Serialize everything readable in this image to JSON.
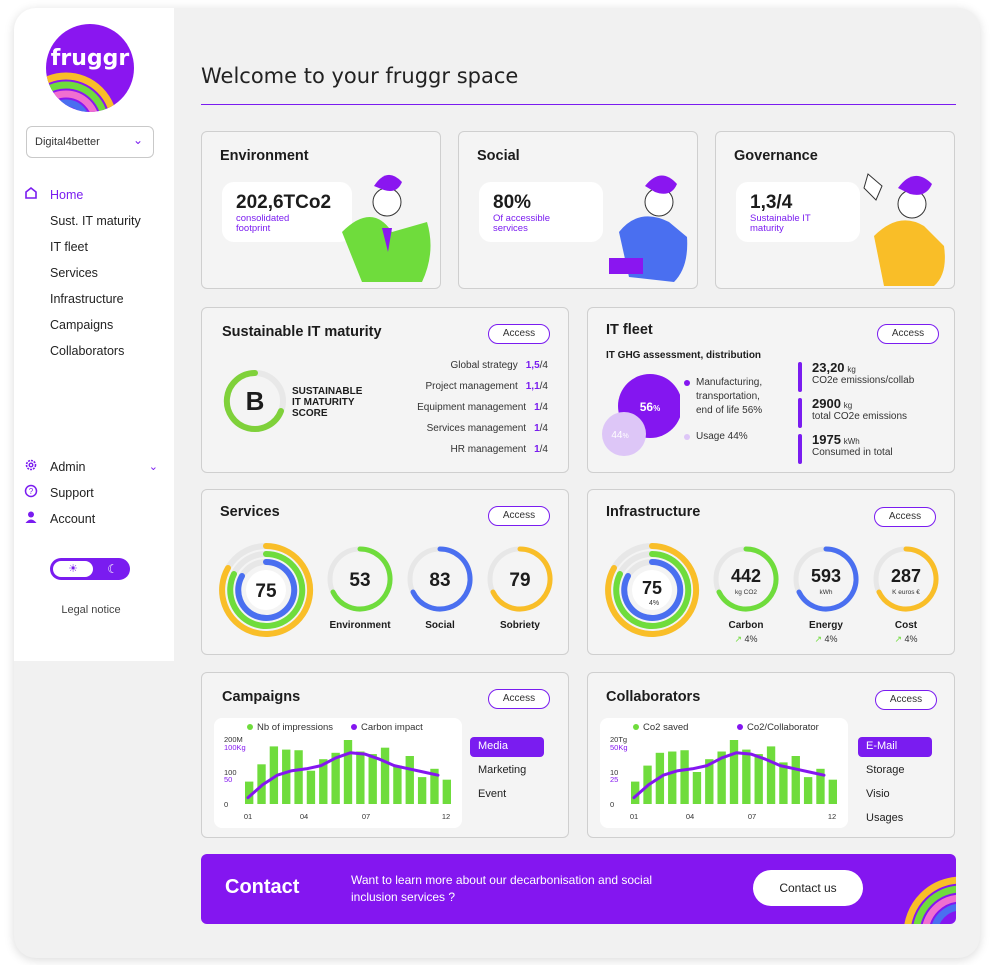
{
  "brand": {
    "name": "fruggr",
    "accent": "#7a1cf0"
  },
  "sidebar": {
    "org_select": "Digital4better",
    "items": [
      {
        "label": "Home",
        "icon": "home-icon"
      },
      {
        "label": "Sust. IT maturity"
      },
      {
        "label": "IT fleet"
      },
      {
        "label": "Services"
      },
      {
        "label": "Infrastructure"
      },
      {
        "label": "Campaigns"
      },
      {
        "label": "Collaborators"
      }
    ],
    "bottom": [
      {
        "label": "Admin",
        "icon": "gear-icon"
      },
      {
        "label": "Support",
        "icon": "help-icon"
      },
      {
        "label": "Account",
        "icon": "user-icon"
      }
    ],
    "legal": "Legal notice"
  },
  "main": {
    "title": "Welcome to your fruggr space"
  },
  "cards": {
    "environment": {
      "title": "Environment",
      "value": "202,6TCo2",
      "sub1": "consolidated",
      "sub2": "footprint"
    },
    "social": {
      "title": "Social",
      "value": "80%",
      "sub1": "Of accessible",
      "sub2": "services"
    },
    "governance": {
      "title": "Governance",
      "value": "1,3/4",
      "sub1": "Sustainable IT",
      "sub2": "maturity"
    }
  },
  "maturity": {
    "title": "Sustainable IT maturity",
    "access": "Access",
    "grade": "B",
    "score_l1": "SUSTAINABLE",
    "score_l2": "IT MATURITY",
    "score_l3": "SCORE",
    "rows": [
      {
        "label": "Global strategy",
        "value": "1,5",
        "max": "/4"
      },
      {
        "label": "Project management",
        "value": "1,1",
        "max": "/4"
      },
      {
        "label": "Equipment management",
        "value": "1",
        "max": "/4"
      },
      {
        "label": "Services management",
        "value": "1",
        "max": "/4"
      },
      {
        "label": "HR management",
        "value": "1",
        "max": "/4"
      }
    ]
  },
  "fleet": {
    "title": "IT fleet",
    "access": "Access",
    "subtitle": "IT GHG assessment, distribution",
    "big_pct": "56",
    "big_unit": "%",
    "small_pct": "44",
    "small_unit": "%",
    "legend1_a": "Manufacturing,",
    "legend1_b": "transportation,",
    "legend1_c": "end of life 56%",
    "legend2": "Usage 44%",
    "metrics": [
      {
        "value": "23,20",
        "unit": "kg",
        "label": "CO2e emissions/collab"
      },
      {
        "value": "2900",
        "unit": "kg",
        "label": "total CO2e emissions"
      },
      {
        "value": "1975",
        "unit": "kWh",
        "label": "Consumed in total"
      }
    ]
  },
  "services": {
    "title": "Services",
    "access": "Access",
    "main": "75",
    "gauges": [
      {
        "value": "53",
        "label": "Environment",
        "color": "#6fdc3c"
      },
      {
        "value": "83",
        "label": "Social",
        "color": "#4a6ff0"
      },
      {
        "value": "79",
        "label": "Sobriety",
        "color": "#f9be28"
      }
    ]
  },
  "infra": {
    "title": "Infrastructure",
    "access": "Access",
    "main": "75",
    "main_delta": "4%",
    "gauges": [
      {
        "value": "442",
        "unit": "kg CO2",
        "label": "Carbon",
        "delta": "4%",
        "color": "#6fdc3c"
      },
      {
        "value": "593",
        "unit": "kWh",
        "label": "Energy",
        "delta": "4%",
        "color": "#4a6ff0"
      },
      {
        "value": "287",
        "unit": "K euros €",
        "label": "Cost",
        "delta": "4%",
        "color": "#f9be28"
      }
    ]
  },
  "campaigns": {
    "title": "Campaigns",
    "access": "Access",
    "legend_a": "Nb of impressions",
    "legend_b": "Carbon impact",
    "y_top_a": "200M",
    "y_top_b": "100Kg",
    "y_mid_a": "100",
    "y_mid_b": "50",
    "y_zero": "0",
    "x_ticks": [
      "01",
      "04",
      "07",
      "12"
    ],
    "bars": [
      0.35,
      0.62,
      0.9,
      0.85,
      0.84,
      0.52,
      0.7,
      0.8,
      1.0,
      0.82,
      0.78,
      0.88,
      0.6,
      0.75,
      0.42,
      0.55,
      0.38
    ],
    "line": [
      0.1,
      0.3,
      0.45,
      0.52,
      0.55,
      0.6,
      0.72,
      0.8,
      0.78,
      0.7,
      0.6,
      0.55,
      0.5,
      0.45
    ],
    "menu": [
      "Media",
      "Marketing",
      "Event"
    ],
    "menu_selected": 0
  },
  "collaborators": {
    "title": "Collaborators",
    "access": "Access",
    "legend_a": "Co2 saved",
    "legend_b": "Co2/Collaborator",
    "y_top_a": "20Tg",
    "y_top_b": "50Kg",
    "y_mid_a": "10",
    "y_mid_b": "25",
    "y_zero": "0",
    "x_ticks": [
      "01",
      "04",
      "07",
      "12"
    ],
    "bars": [
      0.35,
      0.6,
      0.8,
      0.82,
      0.84,
      0.5,
      0.7,
      0.82,
      1.0,
      0.85,
      0.78,
      0.9,
      0.65,
      0.75,
      0.42,
      0.55,
      0.38
    ],
    "line": [
      0.1,
      0.3,
      0.45,
      0.52,
      0.55,
      0.6,
      0.72,
      0.8,
      0.78,
      0.7,
      0.6,
      0.55,
      0.5,
      0.45
    ],
    "menu": [
      "E-Mail",
      "Storage",
      "Visio",
      "Usages"
    ],
    "menu_selected": 0
  },
  "contact": {
    "title": "Contact",
    "text": "Want to learn more about our decarbonisation and social inclusion services ?",
    "button": "Contact us"
  }
}
